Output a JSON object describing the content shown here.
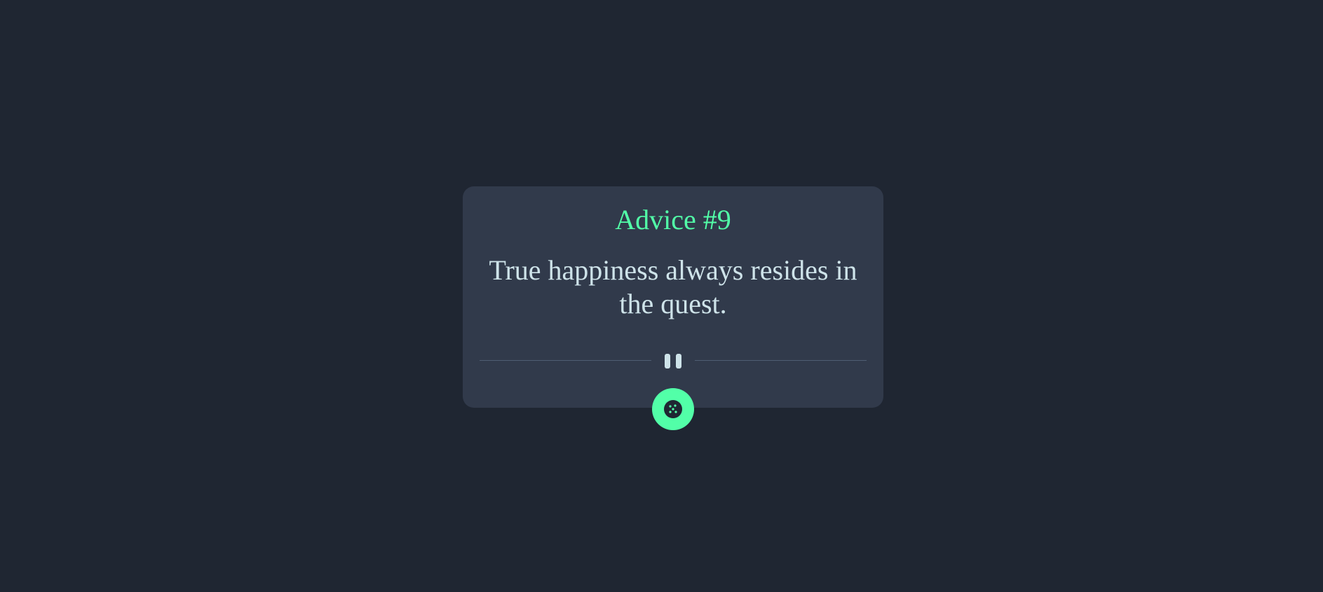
{
  "advice": {
    "title": "Advice #9",
    "quote": "True happiness always resides in the quest."
  },
  "divider": {
    "icon": "pause-icon"
  },
  "dice_button": {
    "icon": "dice-icon"
  },
  "colors": {
    "background": "#1f2632",
    "card": "#313a4b",
    "accent": "#52ffa8",
    "text": "#cee3e9",
    "divider": "#4f5d73"
  }
}
